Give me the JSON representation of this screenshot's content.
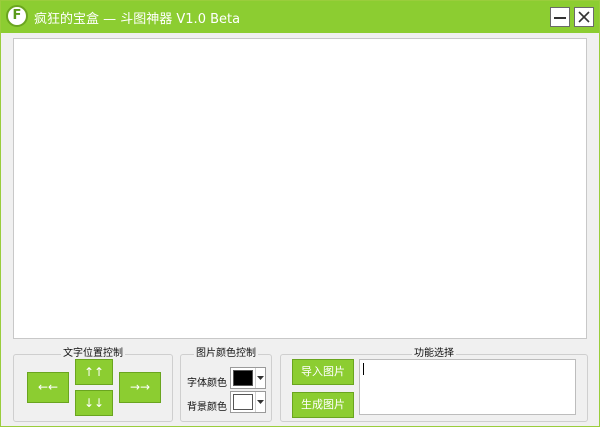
{
  "window": {
    "title": "疯狂的宝盒 — 斗图神器  V1.0 Beta",
    "icon_letter": "F",
    "icon": "app-logo-icon",
    "accent_color": "#8ccd31"
  },
  "controls": {
    "minimize_icon": "minimize-icon",
    "close_icon": "close-icon"
  },
  "text_position": {
    "legend": "文字位置控制",
    "left_label": "←←",
    "up_label": "↑↑",
    "down_label": "↓↓",
    "right_label": "→→"
  },
  "image_color": {
    "legend": "图片颜色控制",
    "font_color_label": "字体颜色",
    "font_color_value": "#000000",
    "bg_color_label": "背景颜色",
    "bg_color_value": "#ffffff"
  },
  "functions": {
    "legend": "功能选择",
    "import_label": "导入图片",
    "generate_label": "生成图片",
    "text_value": ""
  }
}
